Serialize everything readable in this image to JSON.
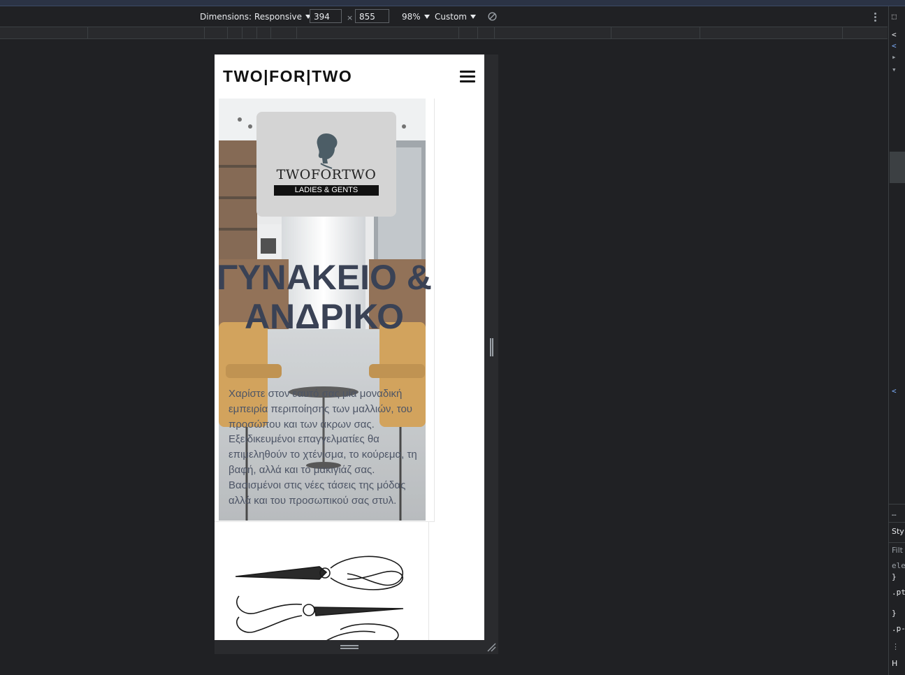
{
  "devtools": {
    "dimensions_label": "Dimensions: Responsive",
    "width": "394",
    "height": "855",
    "times": "×",
    "zoom": "98%",
    "throttle": "Custom"
  },
  "side_panel": {
    "lines": [
      "<",
      "<",
      "▸",
      "▾",
      "…",
      "<",
      "…",
      "Sty",
      "Filt",
      "ele",
      "}",
      ".pt",
      "}",
      ".p-",
      "⋮",
      "H"
    ]
  },
  "site": {
    "brand": "TWO|FOR|TWO",
    "logo_name": "TWOFORTWO",
    "logo_tagline": "LADIES & GENTS",
    "hero_title": "ΓΥΝΑΚΕΙΟ & ΑΝΔΡΙΚΟ",
    "hero_text": "Χαρίστε στον εαυτό σας μία μοναδική εμπειρία περιποίησης των μαλλιών, του προσώπου και των άκρων σας. Εξειδικευμένοι επαγγελματίες θα επιμεληθούν το χτένισμα, το κούρεμα, τη βαφή, αλλά και το μακιγιάζ σας. Βασισμένοι στις νέες τάσεις της μόδας αλλά και του προσωπικού σας στυλ."
  }
}
